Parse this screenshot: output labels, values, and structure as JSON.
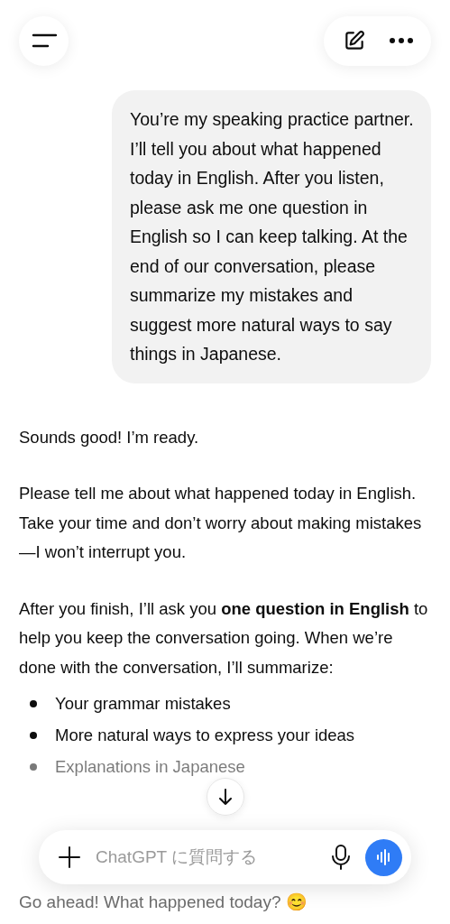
{
  "user_message": "You’re my speaking practice partner. I’ll tell you about what happened today in English. After you listen, please ask me one question in English so I can keep talking. At the end of our conversation, please summarize my mistakes and suggest more natural ways to say things in Japanese.",
  "assistant_message": {
    "paragraphs": [
      "Sounds good! I’m ready.",
      "Please tell me about what happened today in English. Take your time and don’t worry about making mistakes—I won’t interrupt you.",
      "After you finish, I’ll ask you **one question in English** to help you keep the conversation going. When we’re done with the conversation, I’ll summarize:"
    ],
    "bullets": [
      "Your grammar mistakes",
      "More natural ways to express your ideas",
      "Explanations in Japanese"
    ],
    "trailing": "Go ahead! What happened today? 😊"
  },
  "composer": {
    "placeholder": "ChatGPT に質問する"
  }
}
